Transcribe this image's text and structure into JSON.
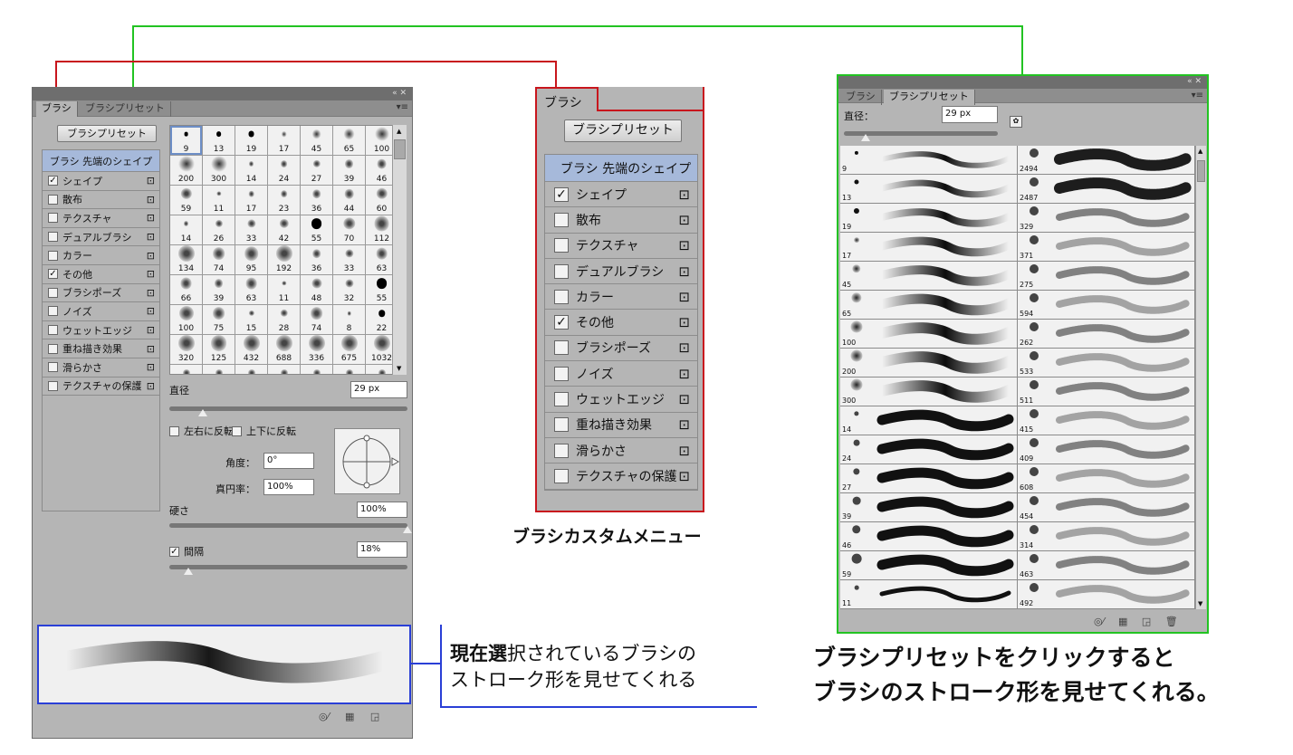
{
  "left_panel": {
    "title_icons": "«  ✕",
    "tabs": [
      "ブラシ",
      "ブラシプリセット"
    ],
    "menu_icon": "▾≡",
    "preset_button": "ブラシプリセット",
    "list_header": "ブラシ 先端のシェイプ",
    "options": [
      {
        "label": "シェイプ",
        "checked": true
      },
      {
        "label": "散布",
        "checked": false
      },
      {
        "label": "テクスチャ",
        "checked": false
      },
      {
        "label": "デュアルブラシ",
        "checked": false
      },
      {
        "label": "カラー",
        "checked": false
      },
      {
        "label": "その他",
        "checked": true
      },
      {
        "label": "ブラシポーズ",
        "checked": false
      },
      {
        "label": "ノイズ",
        "checked": false
      },
      {
        "label": "ウェットエッジ",
        "checked": false
      },
      {
        "label": "重ね描き効果",
        "checked": false
      },
      {
        "label": "滑らかさ",
        "checked": false
      },
      {
        "label": "テクスチャの保護",
        "checked": false
      }
    ],
    "brush_sizes": [
      9,
      13,
      19,
      17,
      45,
      65,
      100,
      200,
      300,
      14,
      24,
      27,
      39,
      46,
      59,
      11,
      17,
      23,
      36,
      44,
      60,
      14,
      26,
      33,
      42,
      55,
      70,
      112,
      134,
      74,
      95,
      192,
      36,
      33,
      63,
      66,
      39,
      63,
      11,
      48,
      32,
      55,
      100,
      75,
      15,
      28,
      74,
      8,
      22,
      320,
      125,
      432,
      688,
      336,
      675,
      1032,
      "",
      "",
      "",
      "",
      "",
      "",
      ""
    ],
    "selected_brush": 9,
    "diameter_label": "直径",
    "diameter_value": "29 px",
    "diameter_fraction": 0.14,
    "flip_x_label": "左右に反転",
    "flip_y_label": "上下に反転",
    "angle_label": "角度：",
    "angle_value": "0°",
    "roundness_label": "真円率：",
    "roundness_value": "100%",
    "hardness_label": "硬さ",
    "hardness_value": "100%",
    "hardness_fraction": 1.0,
    "spacing_label": "間隔",
    "spacing_checked": true,
    "spacing_value": "18%",
    "spacing_fraction": 0.08,
    "footer_icons": [
      "brush-icon",
      "grid-icon",
      "new-icon"
    ]
  },
  "annotation_left": {
    "bold_part1": "現在選",
    "normal_part1": "択",
    "bold_part2": "選",
    "line1_rest": "されているブラシの",
    "line2": "ストローク形を見せてくれる"
  },
  "custom_menu": {
    "tab": "ブラシ",
    "preset_button": "ブラシプリセット",
    "caption": "ブラシカスタムメニュー"
  },
  "right_panel": {
    "title_icons": "«  ✕",
    "tabs": [
      "ブラシ",
      "ブラシプリセット"
    ],
    "menu_icon": "▾≡",
    "diameter_label": "直径：",
    "diameter_value": "29 px",
    "diameter_fraction": 0.14,
    "left_sizes": [
      9,
      13,
      19,
      17,
      45,
      65,
      100,
      200,
      300,
      14,
      24,
      27,
      39,
      46,
      59,
      11
    ],
    "right_sizes": [
      2494,
      2487,
      329,
      371,
      275,
      594,
      262,
      533,
      511,
      415,
      409,
      608,
      454,
      314,
      463,
      492
    ],
    "caption_line1": "ブラシプリセットをクリックすると",
    "caption_line2": "ブラシのストローク形を見せてくれる。"
  },
  "colors": {
    "green": "#22c322",
    "red": "#c8161d",
    "blue": "#2a3fd6",
    "header": "#a6b9da"
  }
}
